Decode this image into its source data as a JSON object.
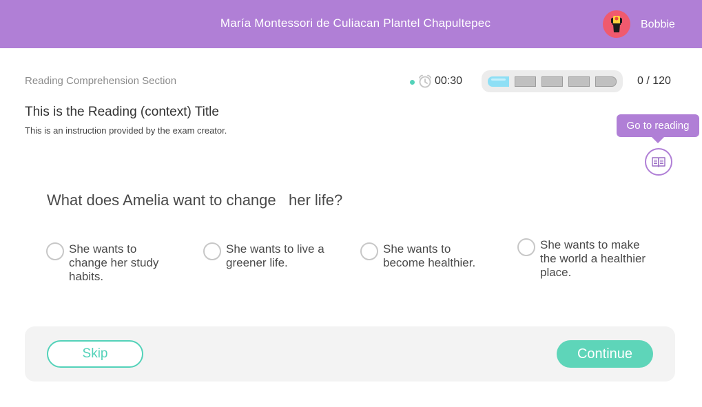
{
  "header": {
    "school_name": "María Montessori de Culiacan Plantel Chapultepec",
    "user_name": "Bobbie",
    "avatar_icon": "lighthouse-avatar-icon",
    "background_color": "#b07fd6"
  },
  "status_bar": {
    "section_label": "Reading Comprehension Section",
    "timer_icon": "alarm-clock-icon",
    "timer": "00:30",
    "progress_segments_total": 5,
    "progress_segments_active": 1,
    "score": "0 / 120"
  },
  "reading": {
    "title": "This is the Reading (context) Title",
    "instruction": "This is an instruction provided by the exam creator.",
    "go_to_reading_tooltip": "Go to reading",
    "book_icon": "open-book-icon"
  },
  "question": {
    "text": "What does Amelia want to change   her life?",
    "options": [
      {
        "label": "She wants to change her study habits.",
        "selected": false
      },
      {
        "label": "She wants to live a greener life.",
        "selected": false
      },
      {
        "label": "She wants to become healthier.",
        "selected": false
      },
      {
        "label": "She wants to make the world a healthier place.",
        "selected": false
      }
    ]
  },
  "footer": {
    "skip_label": "Skip",
    "continue_label": "Continue",
    "accent_color": "#53d2b9"
  }
}
